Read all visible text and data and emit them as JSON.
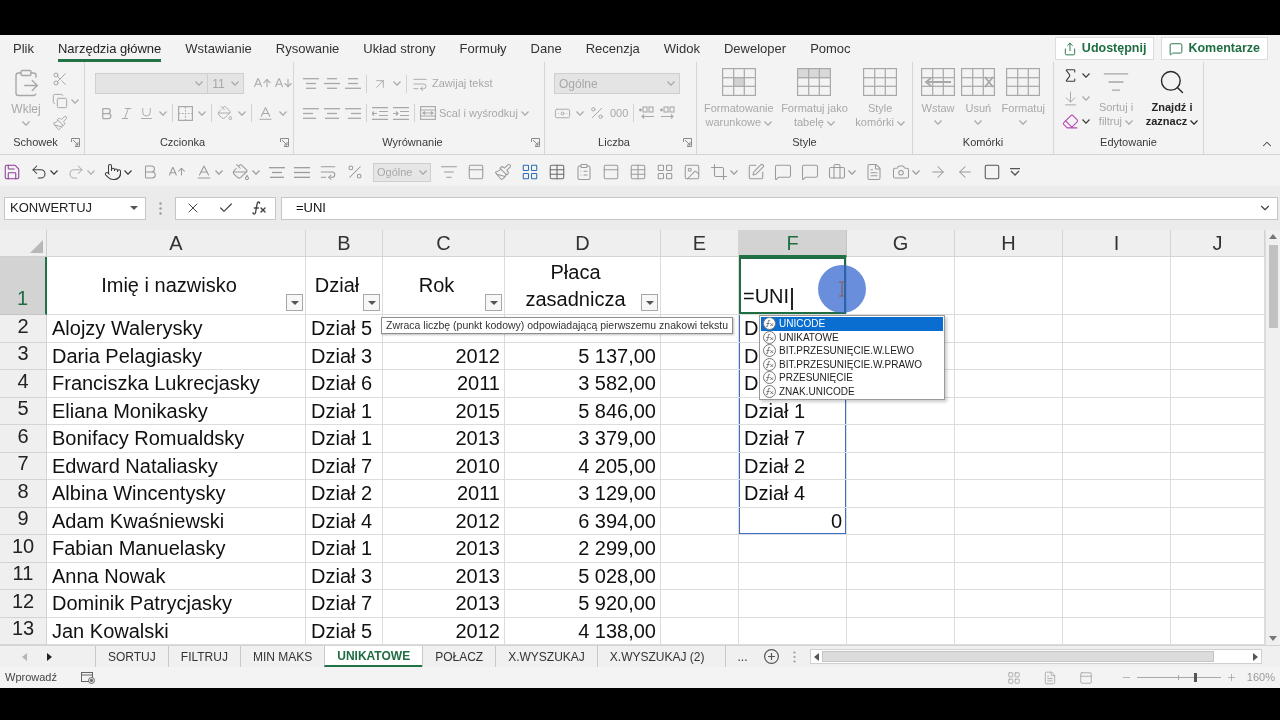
{
  "ribbon": {
    "tabs": [
      {
        "label": "Plik",
        "selected": false
      },
      {
        "label": "Narzędzia główne",
        "selected": true
      },
      {
        "label": "Wstawianie",
        "selected": false
      },
      {
        "label": "Rysowanie",
        "selected": false
      },
      {
        "label": "Układ strony",
        "selected": false
      },
      {
        "label": "Formuły",
        "selected": false
      },
      {
        "label": "Dane",
        "selected": false
      },
      {
        "label": "Recenzja",
        "selected": false
      },
      {
        "label": "Widok",
        "selected": false
      },
      {
        "label": "Deweloper",
        "selected": false
      },
      {
        "label": "Pomoc",
        "selected": false
      }
    ],
    "share_button": "Udostępnij",
    "comments_button": "Komentarze",
    "groups": [
      {
        "label": "Schowek",
        "disabled": true,
        "paste_label": "Wklej"
      },
      {
        "label": "Czcionka",
        "disabled": true,
        "font_size": "11"
      },
      {
        "label": "Wyrównanie",
        "disabled": true,
        "wrap_text": "Zawijaj tekst",
        "merge": "Scal i wyśrodkuj"
      },
      {
        "label": "Liczba",
        "disabled": true,
        "number_format": "Ogólne",
        "thousands": "000"
      },
      {
        "label": "Style",
        "disabled": true,
        "buttons": [
          "Formatowanie warunkowe",
          "Formatuj jako tabelę",
          "Style komórki"
        ]
      },
      {
        "label": "Komórki",
        "disabled": true,
        "buttons": [
          "Wstaw",
          "Usuń",
          "Formatuj"
        ]
      },
      {
        "label": "Edytowanie",
        "tools": [
          {
            "kind": "autosum",
            "disabled": false
          },
          {
            "kind": "fill",
            "disabled": true
          },
          {
            "kind": "clear",
            "disabled": false
          }
        ],
        "buttons": [
          {
            "label": "Sortuj i filtruj",
            "disabled": true
          },
          {
            "label": "Znajdź i zaznacz",
            "disabled": false
          }
        ]
      }
    ]
  },
  "quick_access": {
    "number_format": "Ogólne",
    "disabled": true
  },
  "formula_bar": {
    "name_box": "KONWERTUJ",
    "formula": "=UNI"
  },
  "grid": {
    "columns": [
      {
        "letter": "A",
        "selected": false
      },
      {
        "letter": "B",
        "selected": false
      },
      {
        "letter": "C",
        "selected": false
      },
      {
        "letter": "D",
        "selected": false
      },
      {
        "letter": "E",
        "selected": false
      },
      {
        "letter": "F",
        "selected": true
      },
      {
        "letter": "G",
        "selected": false
      },
      {
        "letter": "H",
        "selected": false
      },
      {
        "letter": "I",
        "selected": false
      },
      {
        "letter": "J",
        "selected": false
      }
    ],
    "rows": [
      {
        "number": "1",
        "selected": true,
        "spill": false,
        "cells": {
          "A": {
            "text": "Imię i nazwisko",
            "kind": "header",
            "filter": true
          },
          "B": {
            "text": "Dział",
            "kind": "header",
            "filter": true
          },
          "C": {
            "text": "Rok",
            "kind": "header",
            "filter": true
          },
          "D": {
            "text": "Płaca zasadnicza",
            "kind": "header",
            "filter": true
          },
          "F": {
            "text": "=UNI",
            "kind": "editing"
          }
        }
      },
      {
        "number": "2",
        "selected": false,
        "spill": true,
        "cells": {
          "A": {
            "text": "Alojzy Walerysky",
            "kind": "text"
          },
          "B": {
            "text": "Dział 5",
            "kind": "text"
          },
          "F": {
            "text": "D",
            "kind": "text"
          }
        }
      },
      {
        "number": "3",
        "selected": false,
        "spill": true,
        "cells": {
          "A": {
            "text": "Daria Pelagiasky",
            "kind": "text"
          },
          "B": {
            "text": "Dział 3",
            "kind": "text"
          },
          "C": {
            "text": "2012",
            "kind": "number"
          },
          "D": {
            "text": "5 137,00",
            "kind": "number"
          },
          "F": {
            "text": "D",
            "kind": "text"
          }
        }
      },
      {
        "number": "4",
        "selected": false,
        "spill": true,
        "cells": {
          "A": {
            "text": "Franciszka Lukrecjasky",
            "kind": "text"
          },
          "B": {
            "text": "Dział 6",
            "kind": "text"
          },
          "C": {
            "text": "2011",
            "kind": "number"
          },
          "D": {
            "text": "3 582,00",
            "kind": "number"
          },
          "F": {
            "text": "D",
            "kind": "text"
          }
        }
      },
      {
        "number": "5",
        "selected": false,
        "spill": true,
        "cells": {
          "A": {
            "text": "Eliana Monikasky",
            "kind": "text"
          },
          "B": {
            "text": "Dział 1",
            "kind": "text"
          },
          "C": {
            "text": "2015",
            "kind": "number"
          },
          "D": {
            "text": "5 846,00",
            "kind": "number"
          },
          "F": {
            "text": "Dział 1",
            "kind": "text"
          }
        }
      },
      {
        "number": "6",
        "selected": false,
        "spill": true,
        "cells": {
          "A": {
            "text": "Bonifacy Romualdsky",
            "kind": "text"
          },
          "B": {
            "text": "Dział 1",
            "kind": "text"
          },
          "C": {
            "text": "2013",
            "kind": "number"
          },
          "D": {
            "text": "3 379,00",
            "kind": "number"
          },
          "F": {
            "text": "Dział 7",
            "kind": "text"
          }
        }
      },
      {
        "number": "7",
        "selected": false,
        "spill": true,
        "cells": {
          "A": {
            "text": "Edward Nataliasky",
            "kind": "text"
          },
          "B": {
            "text": "Dział 7",
            "kind": "text"
          },
          "C": {
            "text": "2010",
            "kind": "number"
          },
          "D": {
            "text": "4 205,00",
            "kind": "number"
          },
          "F": {
            "text": "Dział 2",
            "kind": "text"
          }
        }
      },
      {
        "number": "8",
        "selected": false,
        "spill": true,
        "cells": {
          "A": {
            "text": "Albina Wincentysky",
            "kind": "text"
          },
          "B": {
            "text": "Dział 2",
            "kind": "text"
          },
          "C": {
            "text": "2011",
            "kind": "number"
          },
          "D": {
            "text": "3 129,00",
            "kind": "number"
          },
          "F": {
            "text": "Dział 4",
            "kind": "text"
          }
        }
      },
      {
        "number": "9",
        "selected": false,
        "spill": true,
        "cells": {
          "A": {
            "text": "Adam Kwaśniewski",
            "kind": "text"
          },
          "B": {
            "text": "Dział 4",
            "kind": "text"
          },
          "C": {
            "text": "2012",
            "kind": "number"
          },
          "D": {
            "text": "6 394,00",
            "kind": "number"
          },
          "F": {
            "text": "0",
            "kind": "number"
          }
        }
      },
      {
        "number": "10",
        "selected": false,
        "spill": false,
        "cells": {
          "A": {
            "text": "Fabian Manuelasky",
            "kind": "text"
          },
          "B": {
            "text": "Dział 1",
            "kind": "text"
          },
          "C": {
            "text": "2013",
            "kind": "number"
          },
          "D": {
            "text": "2 299,00",
            "kind": "number"
          }
        }
      },
      {
        "number": "11",
        "selected": false,
        "spill": false,
        "cells": {
          "A": {
            "text": "Anna Nowak",
            "kind": "text"
          },
          "B": {
            "text": "Dział 3",
            "kind": "text"
          },
          "C": {
            "text": "2013",
            "kind": "number"
          },
          "D": {
            "text": "5 028,00",
            "kind": "number"
          }
        }
      },
      {
        "number": "12",
        "selected": false,
        "spill": false,
        "cells": {
          "A": {
            "text": "Dominik Patrycjasky",
            "kind": "text"
          },
          "B": {
            "text": "Dział 7",
            "kind": "text"
          },
          "C": {
            "text": "2013",
            "kind": "number"
          },
          "D": {
            "text": "5 920,00",
            "kind": "number"
          }
        }
      },
      {
        "number": "13",
        "selected": false,
        "spill": false,
        "cells": {
          "A": {
            "text": "Jan Kowalski",
            "kind": "text"
          },
          "B": {
            "text": "Dział 5",
            "kind": "text"
          },
          "C": {
            "text": "2012",
            "kind": "number"
          },
          "D": {
            "text": "4 138,00",
            "kind": "number"
          }
        }
      }
    ],
    "tooltip": "Zwraca liczbę (punkt kodowy) odpowiadającą pierwszemu znakowi tekstu",
    "autocomplete": [
      {
        "label": "UNICODE",
        "selected": true
      },
      {
        "label": "UNIKATOWE",
        "selected": false
      },
      {
        "label": "BIT.PRZESUNIĘCIE.W.LEWO",
        "selected": false
      },
      {
        "label": "BIT.PRZESUNIĘCIE.W.PRAWO",
        "selected": false
      },
      {
        "label": "PRZESUNIĘCIE",
        "selected": false
      },
      {
        "label": "ZNAK.UNICODE",
        "selected": false
      }
    ]
  },
  "sheet_tabs": {
    "tabs": [
      {
        "label": "SORTUJ",
        "selected": false
      },
      {
        "label": "FILTRUJ",
        "selected": false
      },
      {
        "label": "MIN MAKS",
        "selected": false
      },
      {
        "label": "UNIKATOWE",
        "selected": true
      },
      {
        "label": "POŁACZ",
        "selected": false
      },
      {
        "label": "X.WYSZUKAJ",
        "selected": false
      },
      {
        "label": "X.WYSZUKAJ (2)",
        "selected": false
      }
    ],
    "more": "..."
  },
  "status_bar": {
    "mode": "Wprowadź",
    "zoom": {
      "level": 0.7,
      "reading": "160%"
    }
  }
}
